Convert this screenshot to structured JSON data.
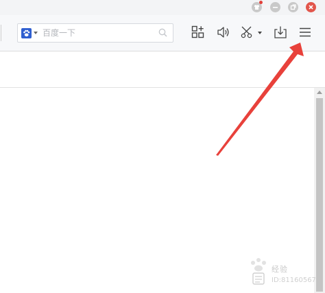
{
  "search": {
    "placeholder": "百度一下",
    "engine_icon": "baidu-paw-icon"
  },
  "window_controls": [
    "skin-icon",
    "minimize-icon",
    "restore-icon",
    "close-icon"
  ],
  "toolbar_icons": [
    "extension-center-icon",
    "sound-icon",
    "screenshot-scissors-icon",
    "download-icon",
    "menu-icon"
  ],
  "watermark": {
    "line1": "经验",
    "line2": "ID:81160567"
  },
  "colors": {
    "arrow": "#e8413b",
    "close_button": "#e2564c",
    "engine_logo": "#2f5fd0"
  }
}
